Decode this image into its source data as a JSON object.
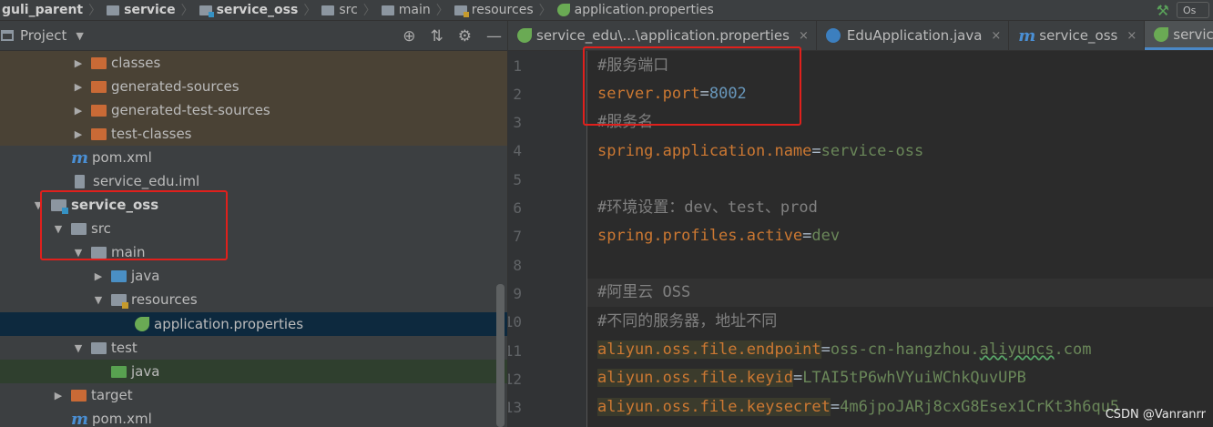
{
  "breadcrumb": [
    "guli_parent",
    "service",
    "service_oss",
    "src",
    "main",
    "resources",
    "application.properties"
  ],
  "top_right": {
    "run_config": "Os"
  },
  "project_panel": {
    "title": "Project"
  },
  "tree": [
    {
      "label": "classes",
      "level": 2,
      "arrow": "▶",
      "icon": "folder-orange"
    },
    {
      "label": "generated-sources",
      "level": 2,
      "arrow": "▶",
      "icon": "folder-orange"
    },
    {
      "label": "generated-test-sources",
      "level": 2,
      "arrow": "▶",
      "icon": "folder-orange"
    },
    {
      "label": "test-classes",
      "level": 2,
      "arrow": "▶",
      "icon": "folder-orange"
    },
    {
      "label": "pom.xml",
      "level": 2,
      "arrow": "",
      "icon": "maven"
    },
    {
      "label": "service_edu.iml",
      "level": 2,
      "arrow": "",
      "icon": "iml"
    },
    {
      "label": "service_oss",
      "level": 1,
      "arrow": "▼",
      "icon": "folder-module"
    },
    {
      "label": "src",
      "level": 2,
      "arrow": "▼",
      "icon": "folder-gray"
    },
    {
      "label": "main",
      "level": 3,
      "arrow": "▼",
      "icon": "folder-gray"
    },
    {
      "label": "java",
      "level": 4,
      "arrow": "▶",
      "icon": "folder-blue"
    },
    {
      "label": "resources",
      "level": 4,
      "arrow": "▼",
      "icon": "folder-resources"
    },
    {
      "label": "application.properties",
      "level": 5,
      "arrow": "",
      "icon": "spring-leaf"
    },
    {
      "label": "test",
      "level": 3,
      "arrow": "▼",
      "icon": "folder-gray"
    },
    {
      "label": "java",
      "level": 4,
      "arrow": "",
      "icon": "folder-green"
    },
    {
      "label": "target",
      "level": 2,
      "arrow": "▶",
      "icon": "folder-orange"
    },
    {
      "label": "pom.xml",
      "level": 2,
      "arrow": "",
      "icon": "maven"
    }
  ],
  "tabs": [
    {
      "label": "service_edu\\...\\application.properties",
      "icon": "spring-leaf",
      "close": "×"
    },
    {
      "label": "EduApplication.java",
      "icon": "class",
      "close": "×"
    },
    {
      "label": "service_oss",
      "icon": "maven",
      "close": "×"
    },
    {
      "label": "service_",
      "icon": "spring-leaf",
      "close": ""
    }
  ],
  "lines": [
    "1",
    "2",
    "3",
    "4",
    "5",
    "6",
    "7",
    "8",
    "9",
    "10",
    "11",
    "12",
    "13"
  ],
  "code": {
    "l1": "#服务端口",
    "l2_key": "server.port",
    "l2_eq": "=",
    "l2_val": "8002",
    "l3": "#服务名",
    "l4_key": "spring.application.name",
    "l4_eq": "=",
    "l4_val": "service-oss",
    "l6": "#环境设置：dev、test、prod",
    "l7_key": "spring.profiles.active",
    "l7_eq": "=",
    "l7_val": "dev",
    "l9": "#阿里云 OSS",
    "l10": "#不同的服务器，地址不同",
    "l11_key": "aliyun.oss.file.endpoint",
    "l11_eq": "=",
    "l11_val_a": "oss-cn-hangzhou.",
    "l11_val_b": "aliyuncs",
    "l11_val_c": ".com",
    "l12_key": "aliyun.oss.file.keyid",
    "l12_eq": "=",
    "l12_val": "LTAI5tP6whVYuiWChkQuvUPB",
    "l13_key": "aliyun.oss.file.keysecret",
    "l13_eq": "=",
    "l13_val": "4m6jpoJARj8cxG8Esex1CrKt3h6qu5"
  },
  "watermark": "CSDN @Vanranrr",
  "colors": {
    "keyword": "#cc7832",
    "string": "#6a8759",
    "number": "#6897bb",
    "comment": "#808080",
    "annotation_box": "#e0201c"
  }
}
